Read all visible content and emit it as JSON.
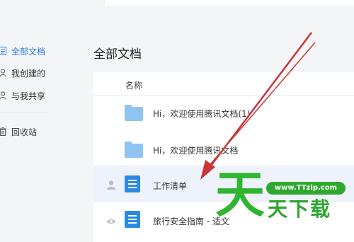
{
  "app": {
    "title_partial": "…"
  },
  "sidebar": {
    "items": [
      {
        "label": "全部文档",
        "icon": "document-list-icon",
        "active": true
      },
      {
        "label": "我创建的",
        "icon": "person-icon",
        "active": false
      },
      {
        "label": "与我共享",
        "icon": "shared-users-icon",
        "active": false
      },
      {
        "label": "回收站",
        "icon": "trash-icon",
        "active": false
      }
    ]
  },
  "main": {
    "title": "全部文档",
    "column_name": "名称",
    "rows": [
      {
        "name": "Hi，欢迎使用腾讯文档(1)",
        "type": "folder",
        "status_icon": ""
      },
      {
        "name": "Hi，欢迎使用腾讯文档",
        "type": "folder",
        "status_icon": ""
      },
      {
        "name": "工作清单",
        "type": "document",
        "status_icon": "person-icon"
      },
      {
        "name": "旅行安全指南 - 适文",
        "type": "document",
        "status_icon": "eye-icon"
      }
    ]
  },
  "watermark": {
    "url": "www.TTzip.com",
    "big_char": "天",
    "sub_text": "天下载"
  },
  "colors": {
    "accent": "#2a7be4",
    "folder": "#8ec3f2",
    "doc": "#2a8ae2",
    "arrow": "#c8363a",
    "watermark": "#2fb52f"
  }
}
